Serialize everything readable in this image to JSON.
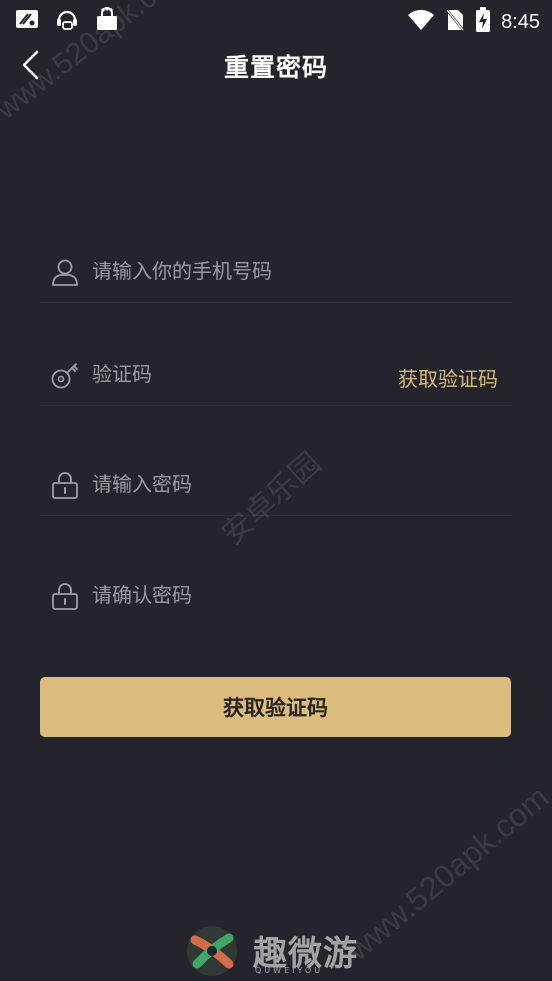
{
  "status_bar": {
    "time": "8:45",
    "icons": [
      "scissor-notification-icon",
      "support-agent-icon",
      "shopping-bag-icon",
      "wifi-icon",
      "no-sim-icon",
      "battery-charging-icon"
    ]
  },
  "header": {
    "title": "重置密码",
    "back_icon": "chevron-left-icon"
  },
  "form": {
    "phone": {
      "placeholder": "请输入你的手机号码",
      "value": "",
      "icon": "user-icon"
    },
    "code": {
      "placeholder": "验证码",
      "value": "",
      "icon": "key-icon",
      "action_label": "获取验证码"
    },
    "password": {
      "placeholder": "请输入密码",
      "value": "",
      "icon": "lock-icon"
    },
    "confirm_password": {
      "placeholder": "请确认密码",
      "value": "",
      "icon": "lock-icon"
    },
    "submit_label": "获取验证码"
  },
  "watermarks": {
    "top": "www.520apk.com",
    "middle": "安卓乐园",
    "bottom": "www.520apk.com"
  },
  "brand": {
    "name": "趣微游",
    "sub": "QUWEIYOU"
  },
  "colors": {
    "background": "#24252c",
    "accent": "#dbbc7c",
    "link": "#d9b977",
    "placeholder": "#9a9a9e"
  }
}
